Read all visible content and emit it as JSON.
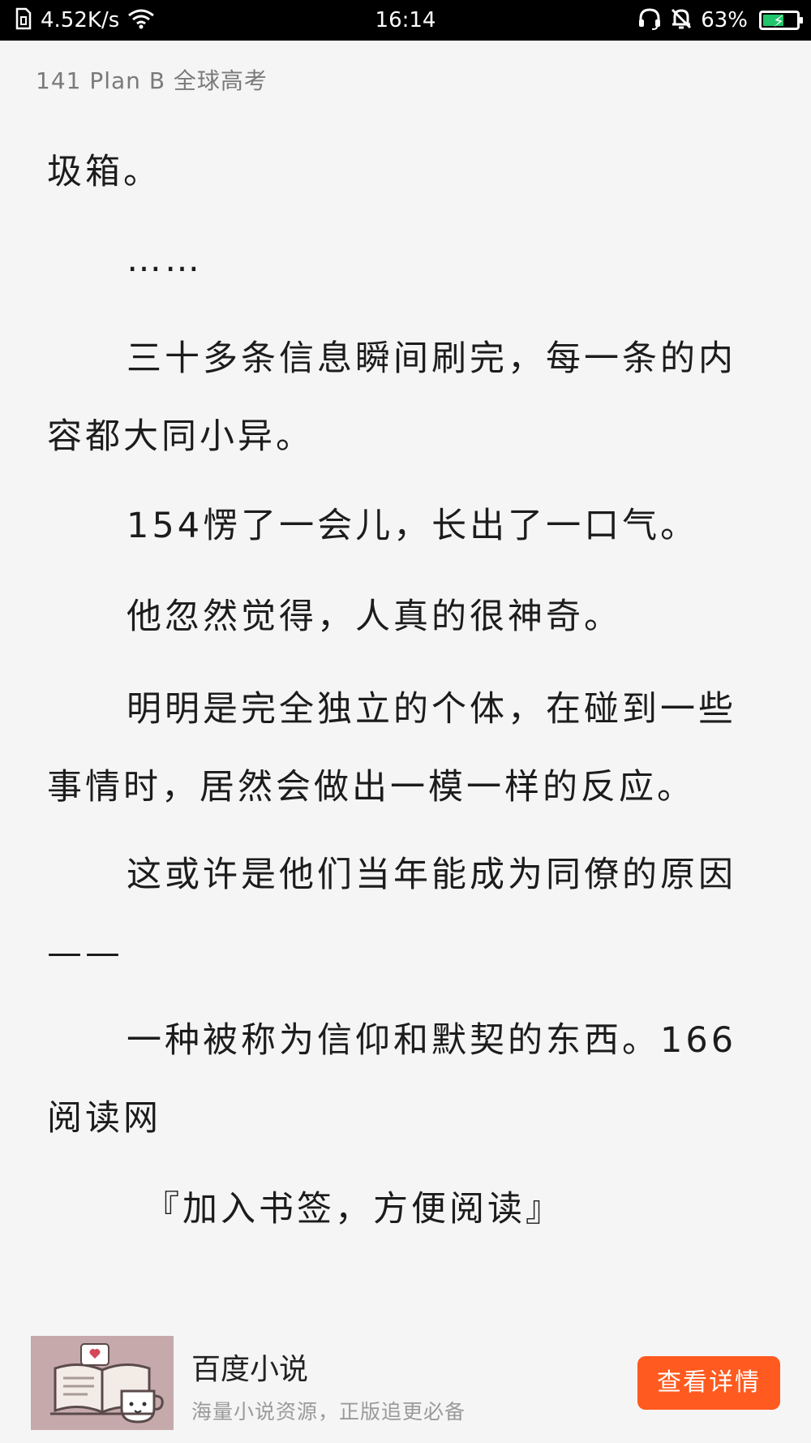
{
  "status_bar": {
    "speed": "4.52K/s",
    "time": "16:14",
    "battery": "63%",
    "battery_level": 0.63
  },
  "header": {
    "chapter": "141 Plan B  全球高考"
  },
  "paragraphs": [
    {
      "text": "圾箱。",
      "indent": false
    },
    {
      "text": "……",
      "indent": true
    },
    {
      "text": "三十多条信息瞬间刷完，每一条的内容都大同小异。",
      "indent": true
    },
    {
      "text": "154愣了一会儿，长出了一口气。",
      "indent": true
    },
    {
      "text": "他忽然觉得，人真的很神奇。",
      "indent": true
    },
    {
      "text": "明明是完全独立的个体，在碰到一些事情时，居然会做出一模一样的反应。",
      "indent": true
    },
    {
      "text": "这或许是他们当年能成为同僚的原因——",
      "indent": true
    },
    {
      "text": "一种被称为信仰和默契的东西。166阅读网",
      "indent": true
    },
    {
      "text": "『加入书签，方便阅读』",
      "indent": true
    }
  ],
  "ad": {
    "title": "百度小说",
    "subtitle": "海量小说资源，正版追更必备",
    "button": "查看详情",
    "accent_color": "#ff5a1f"
  }
}
